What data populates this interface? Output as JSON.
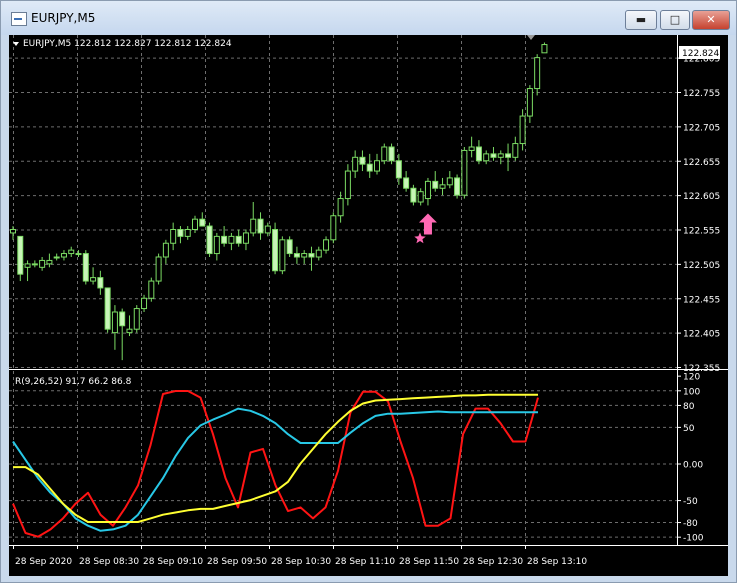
{
  "window": {
    "title": "EURJPY,M5",
    "minimize_icon": "minimize-icon",
    "maximize_icon": "maximize-icon",
    "close_icon": "close-icon"
  },
  "colors": {
    "background": "#000000",
    "grid": "#6e6e6e",
    "axis_text": "#ffffff",
    "candle": "#7cdc64",
    "candle_bull_body": "#000000",
    "candle_bear_body": "#c8f5b8",
    "arrow": "#ff69b4",
    "rsi_fast": "#ff1414",
    "rsi_mid": "#28c8e6",
    "rsi_slow": "#ffff32"
  },
  "price_panel": {
    "header": "EURJPY,M5  122.812 122.827 122.812 122.824",
    "current_price": "122.824",
    "y_ticks": [
      "122.805",
      "122.755",
      "122.705",
      "122.655",
      "122.605",
      "122.555",
      "122.505",
      "122.455",
      "122.405",
      "122.355"
    ]
  },
  "indicator_panel": {
    "header": "R(9,26,52) 91.7 66.2 86.8",
    "y_ticks": [
      "120",
      "100",
      "80",
      "50",
      "0.00",
      "-50",
      "-80",
      "-100"
    ]
  },
  "x_axis": {
    "ticks": [
      "28 Sep 2020",
      "28 Sep 08:30",
      "28 Sep 09:10",
      "28 Sep 09:50",
      "28 Sep 10:30",
      "28 Sep 11:10",
      "28 Sep 11:50",
      "28 Sep 12:30",
      "28 Sep 13:10"
    ]
  },
  "chart_data": [
    {
      "type": "candlestick",
      "symbol": "EURJPY",
      "timeframe": "M5",
      "ohlc_last": {
        "open": 122.812,
        "high": 122.827,
        "low": 122.812,
        "close": 122.824
      },
      "ylim": [
        122.355,
        122.835
      ],
      "candles": [
        [
          122.55,
          122.56,
          122.54,
          122.555
        ],
        [
          122.545,
          122.545,
          122.48,
          122.49
        ],
        [
          122.5,
          122.51,
          122.48,
          122.505
        ],
        [
          122.505,
          122.51,
          122.5,
          122.505
        ],
        [
          122.5,
          122.515,
          122.495,
          122.51
        ],
        [
          122.505,
          122.52,
          122.5,
          122.51
        ],
        [
          122.515,
          122.52,
          122.51,
          122.515
        ],
        [
          122.515,
          122.525,
          122.51,
          122.52
        ],
        [
          122.52,
          122.53,
          122.515,
          122.525
        ],
        [
          122.52,
          122.525,
          122.515,
          122.52
        ],
        [
          122.52,
          122.525,
          122.475,
          122.48
        ],
        [
          122.48,
          122.5,
          122.475,
          122.485
        ],
        [
          122.485,
          122.495,
          122.46,
          122.47
        ],
        [
          122.47,
          122.47,
          122.405,
          122.41
        ],
        [
          122.405,
          122.445,
          122.38,
          122.435
        ],
        [
          122.435,
          122.44,
          122.365,
          122.415
        ],
        [
          122.405,
          122.43,
          122.4,
          122.41
        ],
        [
          122.41,
          122.445,
          122.405,
          122.44
        ],
        [
          122.44,
          122.46,
          122.435,
          122.455
        ],
        [
          122.455,
          122.485,
          122.45,
          122.48
        ],
        [
          122.48,
          122.52,
          122.475,
          122.515
        ],
        [
          122.515,
          122.54,
          122.505,
          122.535
        ],
        [
          122.535,
          122.565,
          122.525,
          122.555
        ],
        [
          122.555,
          122.56,
          122.535,
          122.545
        ],
        [
          122.545,
          122.56,
          122.54,
          122.555
        ],
        [
          122.555,
          122.575,
          122.55,
          122.57
        ],
        [
          122.57,
          122.58,
          122.56,
          122.56
        ],
        [
          122.56,
          122.565,
          122.515,
          122.52
        ],
        [
          122.52,
          122.55,
          122.51,
          122.545
        ],
        [
          122.545,
          122.56,
          122.53,
          122.535
        ],
        [
          122.535,
          122.55,
          122.525,
          122.545
        ],
        [
          122.545,
          122.555,
          122.53,
          122.535
        ],
        [
          122.535,
          122.555,
          122.525,
          122.55
        ],
        [
          122.55,
          122.595,
          122.545,
          122.57
        ],
        [
          122.57,
          122.58,
          122.54,
          122.55
        ],
        [
          122.55,
          122.565,
          122.545,
          122.56
        ],
        [
          122.555,
          122.565,
          122.49,
          122.495
        ],
        [
          122.495,
          122.545,
          122.49,
          122.54
        ],
        [
          122.54,
          122.545,
          122.515,
          122.52
        ],
        [
          122.52,
          122.53,
          122.505,
          122.515
        ],
        [
          122.515,
          122.525,
          122.505,
          122.52
        ],
        [
          122.52,
          122.53,
          122.495,
          122.515
        ],
        [
          122.515,
          122.53,
          122.51,
          122.525
        ],
        [
          122.525,
          122.545,
          122.52,
          122.54
        ],
        [
          122.54,
          122.58,
          122.535,
          122.575
        ],
        [
          122.575,
          122.61,
          122.565,
          122.6
        ],
        [
          122.6,
          122.65,
          122.59,
          122.64
        ],
        [
          122.64,
          122.67,
          122.63,
          122.66
        ],
        [
          122.66,
          122.67,
          122.64,
          122.65
        ],
        [
          122.65,
          122.665,
          122.63,
          122.64
        ],
        [
          122.64,
          122.665,
          122.635,
          122.655
        ],
        [
          122.655,
          122.68,
          122.65,
          122.675
        ],
        [
          122.675,
          122.68,
          122.65,
          122.655
        ],
        [
          122.655,
          122.665,
          122.62,
          122.63
        ],
        [
          122.63,
          122.64,
          122.61,
          122.615
        ],
        [
          122.615,
          122.62,
          122.59,
          122.595
        ],
        [
          122.595,
          122.615,
          122.59,
          122.61
        ],
        [
          122.6,
          122.63,
          122.59,
          122.625
        ],
        [
          122.625,
          122.64,
          122.61,
          122.615
        ],
        [
          122.615,
          122.63,
          122.605,
          122.62
        ],
        [
          122.62,
          122.64,
          122.615,
          122.63
        ],
        [
          122.63,
          122.635,
          122.6,
          122.605
        ],
        [
          122.605,
          122.675,
          122.6,
          122.67
        ],
        [
          122.67,
          122.69,
          122.66,
          122.675
        ],
        [
          122.675,
          122.685,
          122.65,
          122.655
        ],
        [
          122.655,
          122.67,
          122.65,
          122.665
        ],
        [
          122.665,
          122.675,
          122.655,
          122.66
        ],
        [
          122.66,
          122.67,
          122.65,
          122.665
        ],
        [
          122.665,
          122.68,
          122.64,
          122.66
        ],
        [
          122.66,
          122.69,
          122.655,
          122.68
        ],
        [
          122.68,
          122.73,
          122.67,
          122.72
        ],
        [
          122.72,
          122.765,
          122.71,
          122.76
        ],
        [
          122.76,
          122.81,
          122.75,
          122.805
        ],
        [
          122.812,
          122.827,
          122.812,
          122.824
        ]
      ],
      "signal_arrow": {
        "candle_index": 57,
        "direction": "up",
        "shape": "up-arrow with star"
      }
    },
    {
      "type": "line",
      "ylim": [
        -110,
        125
      ],
      "series": [
        {
          "color": "#ff1414",
          "values": [
            -55,
            -95,
            -100,
            -90,
            -75,
            -55,
            -40,
            -70,
            -85,
            -60,
            -30,
            25,
            95,
            99,
            99,
            90,
            40,
            -20,
            -60,
            15,
            20,
            -30,
            -65,
            -60,
            -75,
            -60,
            -10,
            70,
            98,
            98,
            85,
            30,
            -20,
            -85,
            -85,
            -75,
            40,
            75,
            75,
            55,
            30,
            30,
            90
          ]
        },
        {
          "color": "#28c8e6",
          "values": [
            30,
            5,
            -20,
            -40,
            -55,
            -75,
            -85,
            -92,
            -90,
            -85,
            -70,
            -45,
            -20,
            10,
            35,
            52,
            60,
            67,
            75,
            72,
            65,
            55,
            40,
            28,
            28,
            28,
            28,
            42,
            55,
            65,
            68,
            68,
            69,
            70,
            71,
            70,
            70,
            70,
            70,
            70,
            70,
            70,
            70
          ]
        },
        {
          "color": "#ffff32",
          "values": [
            -5,
            -5,
            -15,
            -35,
            -55,
            -70,
            -80,
            -80,
            -80,
            -80,
            -80,
            -75,
            -70,
            -67,
            -64,
            -62,
            -62,
            -58,
            -54,
            -50,
            -44,
            -38,
            -25,
            0,
            20,
            40,
            57,
            72,
            82,
            86,
            87,
            88,
            89,
            90,
            91,
            92,
            93,
            93,
            94,
            94,
            94,
            94,
            94
          ]
        }
      ]
    }
  ]
}
